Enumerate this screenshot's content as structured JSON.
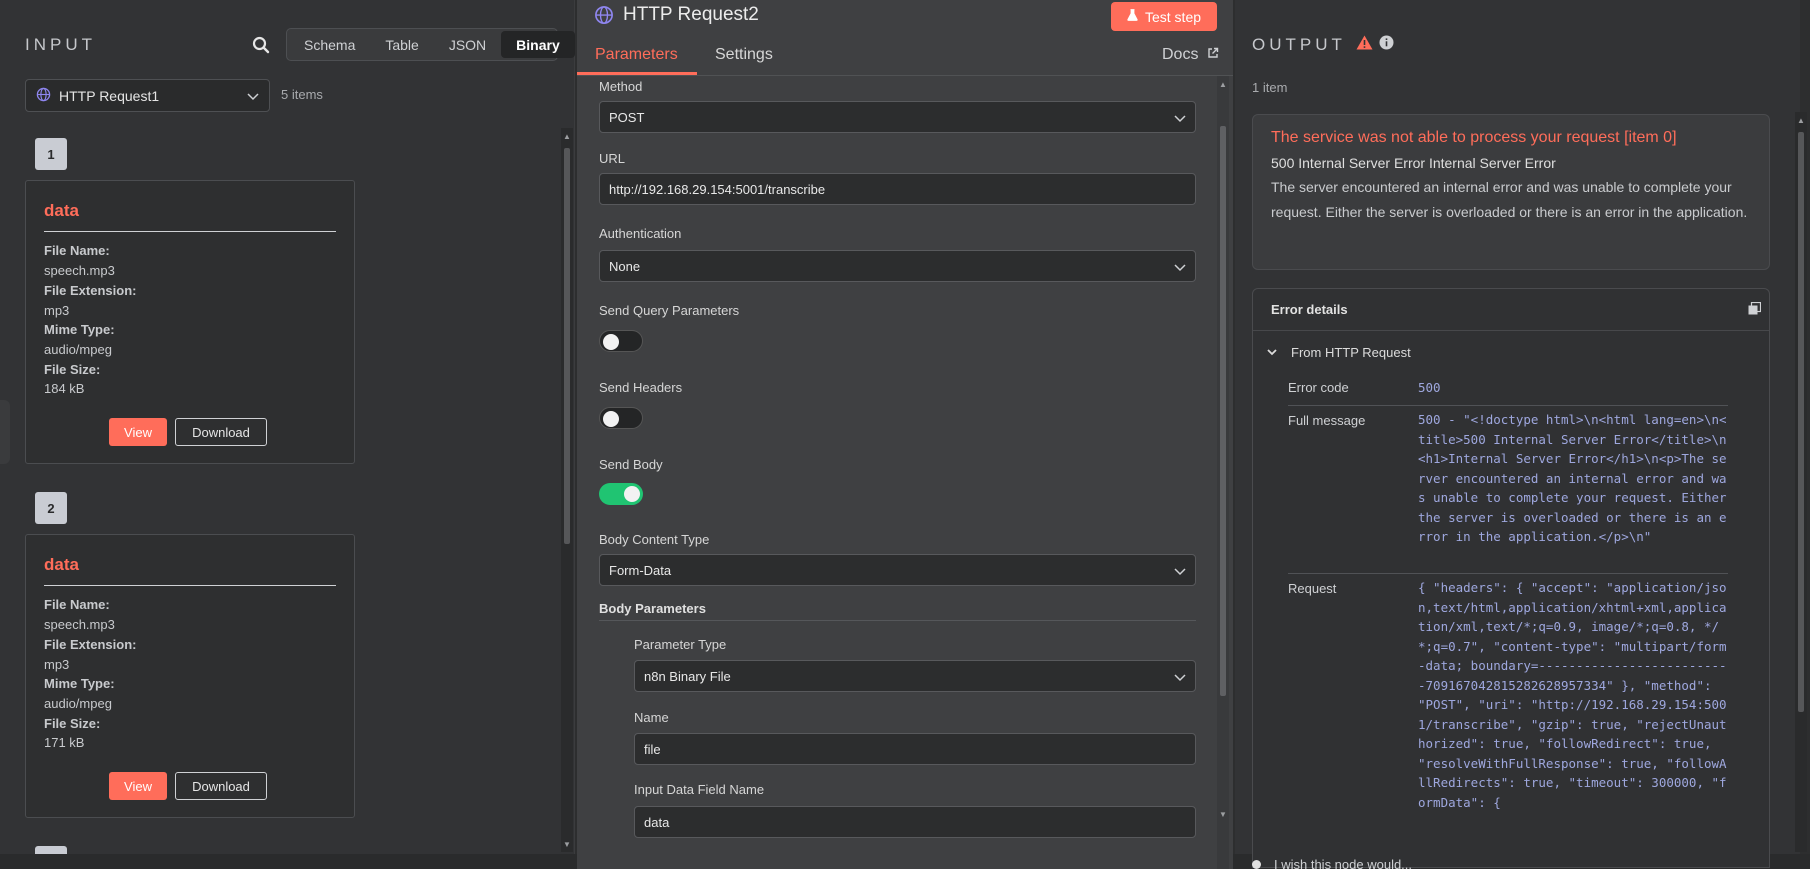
{
  "input": {
    "title": "INPUT",
    "view_tabs": [
      "Schema",
      "Table",
      "JSON",
      "Binary"
    ],
    "active_view": "Binary",
    "source_node": "HTTP Request1",
    "items_count": "5 items",
    "items": [
      {
        "index": "1",
        "title": "data",
        "file_name_label": "File Name:",
        "file_name": "speech.mp3",
        "file_extension_label": "File Extension:",
        "file_extension": "mp3",
        "mime_type_label": "Mime Type:",
        "mime_type": "audio/mpeg",
        "file_size_label": "File Size:",
        "file_size": "184 kB",
        "view_label": "View",
        "download_label": "Download"
      },
      {
        "index": "2",
        "title": "data",
        "file_name_label": "File Name:",
        "file_name": "speech.mp3",
        "file_extension_label": "File Extension:",
        "file_extension": "mp3",
        "mime_type_label": "Mime Type:",
        "mime_type": "audio/mpeg",
        "file_size_label": "File Size:",
        "file_size": "171 kB",
        "view_label": "View",
        "download_label": "Download"
      }
    ]
  },
  "node": {
    "title": "HTTP Request2",
    "icon": "globe-icon",
    "test_step_label": "Test step",
    "tabs": [
      "Parameters",
      "Settings"
    ],
    "active_tab": "Parameters",
    "docs_label": "Docs",
    "params": {
      "method_label": "Method",
      "method_value": "POST",
      "url_label": "URL",
      "url_value": "http://192.168.29.154:5001/transcribe",
      "auth_label": "Authentication",
      "auth_value": "None",
      "send_query_label": "Send Query Parameters",
      "send_query_on": false,
      "send_headers_label": "Send Headers",
      "send_headers_on": false,
      "send_body_label": "Send Body",
      "send_body_on": true,
      "body_content_type_label": "Body Content Type",
      "body_content_type_value": "Form-Data",
      "body_params_label": "Body Parameters",
      "param_type_label": "Parameter Type",
      "param_type_value": "n8n Binary File",
      "name_label": "Name",
      "name_value": "file",
      "input_field_label": "Input Data Field Name",
      "input_field_value": "data"
    }
  },
  "output": {
    "title": "OUTPUT",
    "items_count": "1 item",
    "error_title": "The service was not able to process your request [item 0]",
    "error_subtitle": "500 Internal Server Error Internal Server Error",
    "error_description": "The server encountered an internal error and was unable to complete your request. Either the server is overloaded or there is an error in the application.",
    "details_title": "Error details",
    "from_label": "From HTTP Request",
    "error_code_label": "Error code",
    "error_code": "500",
    "full_message_label": "Full message",
    "full_message": "500 - \"<!doctype html>\\n<html lang=en>\\n<title>500 Internal Server Error</title>\\n<h1>Internal Server Error</h1>\\n<p>The server encountered an internal error and was unable to complete your request. Either the server is overloaded or there is an error in the application.</p>\\n\"",
    "request_label": "Request",
    "request": "{ \"headers\": { \"accept\": \"application/json,text/html,application/xhtml+xml,application/xml,text/*;q=0.9, image/*;q=0.8, */*;q=0.7\", \"content-type\": \"multipart/form-data; boundary=--------------------------709167042815282628957334\" }, \"method\": \"POST\", \"uri\": \"http://192.168.29.154:5001/transcribe\", \"gzip\": true, \"rejectUnauthorized\": true, \"followRedirect\": true, \"resolveWithFullResponse\": true, \"followAllRedirects\": true, \"timeout\": 300000, \"formData\": {",
    "feedback_label": "I wish this node would..."
  },
  "colors": {
    "accent": "#ff6d5a",
    "toggle_on": "#20c472",
    "mono_text": "#9ea7de"
  }
}
